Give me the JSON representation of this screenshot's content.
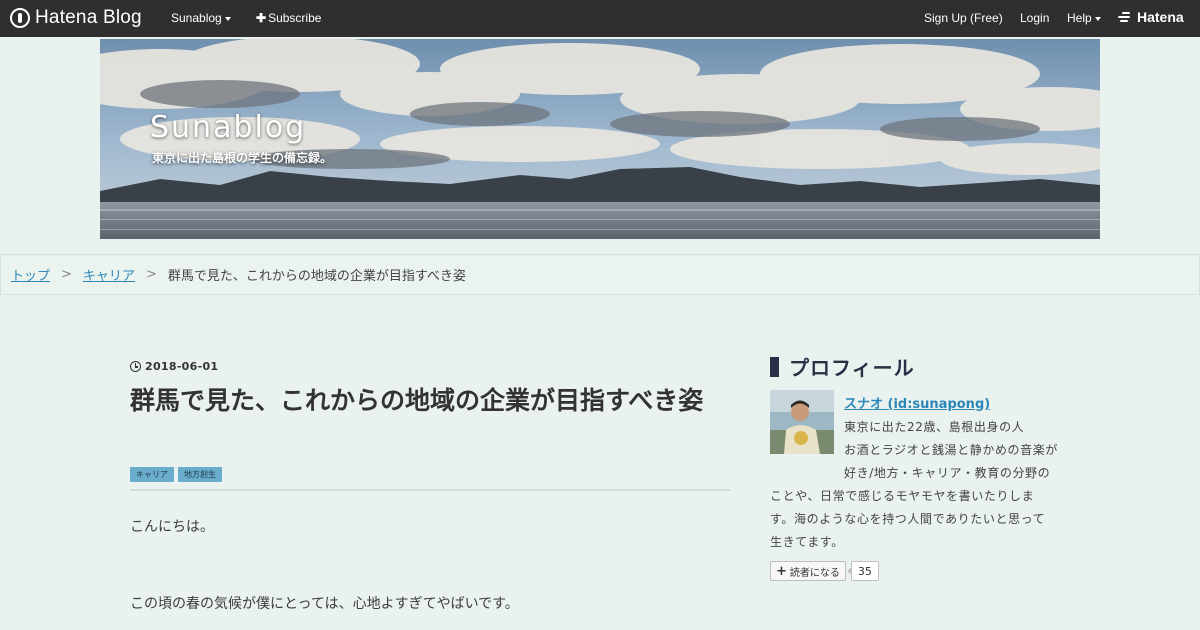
{
  "navbar": {
    "logo": "Hatena Blog",
    "blog_menu": "Sunablog",
    "subscribe": "Subscribe",
    "signup": "Sign Up (Free)",
    "login": "Login",
    "help": "Help",
    "brand": "Hatena",
    "background": "#2f2f2f"
  },
  "header": {
    "title": "Sunablog",
    "description": "東京に出た島根の学生の備忘録。"
  },
  "breadcrumb": {
    "items": [
      "トップ",
      "キャリア"
    ],
    "separator": ">",
    "current": "群馬で見た、これからの地域の企業が目指すべき姿"
  },
  "article": {
    "date": "2018-06-01",
    "title": "群馬で見た、これからの地域の企業が目指すべき姿",
    "categories": [
      "キャリア",
      "地方創生"
    ],
    "paragraphs": [
      "こんにちは。",
      "この頃の春の気候が僕にとっては、心地よすぎてやばいです。"
    ]
  },
  "sidebar": {
    "heading": "プロフィール",
    "profile_name": "スナオ (id:sunapong)",
    "profile_lines": [
      "東京に出た22歳、島根出身の人",
      "お酒とラジオと銭湯と静かめの音楽が",
      "好き/地方・キャリア・教育の分野の",
      "ことや、日常で感じるモヤモヤを書いたりしま",
      "す。海のような心を持つ人間でありたいと思って",
      "生きてます。"
    ],
    "follow_label": "読者になる",
    "follow_count": "35"
  },
  "colors": {
    "page_background": "#e9f2ee",
    "link": "#2c87b8",
    "category_tag": "#6aaccc",
    "heading_accent": "#2a2f45"
  },
  "icons": [
    "hatena-blog-logo-icon",
    "caret-down-icon",
    "plus-icon",
    "hatena-logo-icon",
    "clock-icon"
  ]
}
